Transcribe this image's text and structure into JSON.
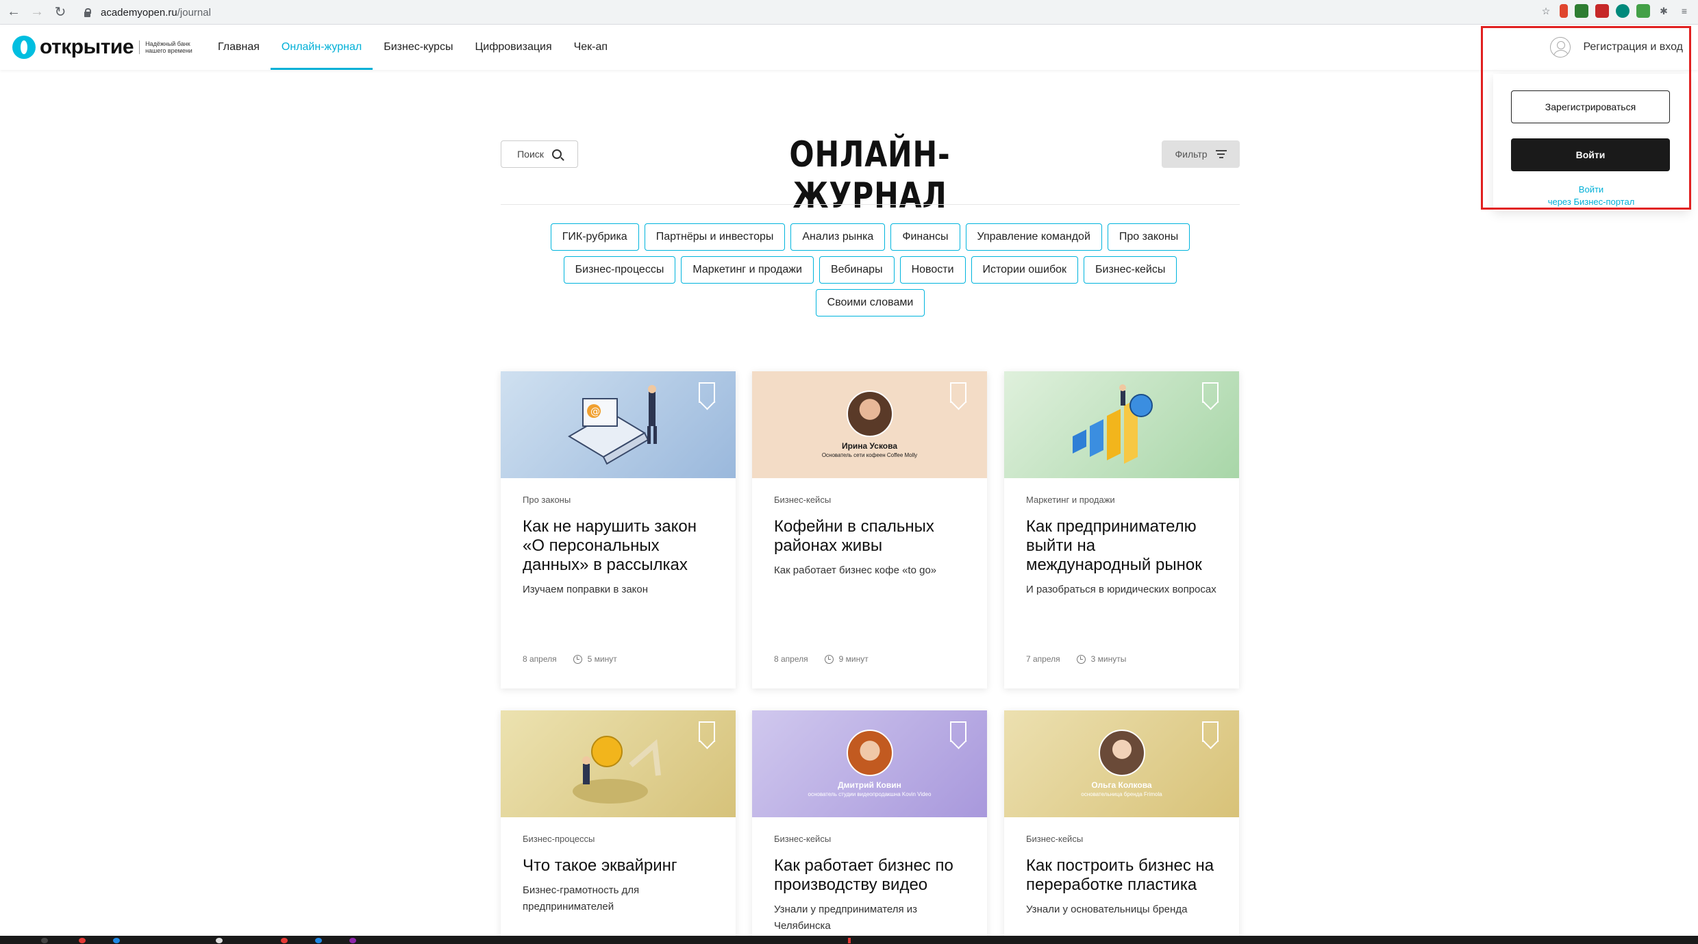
{
  "browser": {
    "url_host": "academyopen.ru",
    "url_path": "/journal"
  },
  "site": {
    "logo_text": "открытие",
    "logo_tagline": "Надёжный банк нашего времени",
    "nav": [
      "Главная",
      "Онлайн-журнал",
      "Бизнес-курсы",
      "Цифровизация",
      "Чек-ап"
    ],
    "auth_link": "Регистрация и вход"
  },
  "auth_dropdown": {
    "register": "Зарегистрироваться",
    "login": "Войти",
    "portal_line1": "Войти",
    "portal_line2": "через Бизнес-портал"
  },
  "journal": {
    "search_label": "Поиск",
    "title": "ОНЛАЙН-ЖУРНАЛ",
    "filter_label": "Фильтр",
    "tags_row1": [
      "ГИК-рубрика",
      "Партнёры и инвесторы",
      "Анализ рынка",
      "Финансы",
      "Управление командой",
      "Про законы"
    ],
    "tags_row2": [
      "Бизнес-процессы",
      "Маркетинг и продажи",
      "Вебинары",
      "Новости",
      "Истории ошибок",
      "Бизнес-кейсы"
    ],
    "tags_row3": [
      "Своими словами"
    ]
  },
  "cards": [
    {
      "category": "Про законы",
      "title": "Как не нарушить закон «О персональных данных» в рассылках",
      "subtitle": "Изучаем поправки в закон",
      "date": "8 апреля",
      "read_time": "5 минут",
      "bg": "#b3cce6"
    },
    {
      "category": "Бизнес-кейсы",
      "title": "Кофейни в спальных районах живы",
      "subtitle": "Как работает бизнес кофе «to go»",
      "date": "8 апреля",
      "read_time": "9 минут",
      "bg": "#f3dcc6",
      "person_name": "Ирина Ускова",
      "person_role": "Основатель сети кофеен Coffee Molly"
    },
    {
      "category": "Маркетинг и продажи",
      "title": "Как предпринимателю выйти на международный рынок",
      "subtitle": "И разобраться в юридических вопросах",
      "date": "7 апреля",
      "read_time": "3 минуты",
      "bg": "#bfe0bf"
    },
    {
      "category": "Бизнес-процессы",
      "title": "Что такое эквайринг",
      "subtitle": "Бизнес-грамотность для предпринимателей",
      "bg": "#e3d8a0"
    },
    {
      "category": "Бизнес-кейсы",
      "title": "Как работает бизнес по производству видео",
      "subtitle": "Узнали у предпринимателя из Челябинска",
      "bg": "#c0b8e6",
      "person_name": "Дмитрий Ковин",
      "person_role": "основатель студии видеопродакшна Kovin Video"
    },
    {
      "category": "Бизнес-кейсы",
      "title": "Как построить бизнес на переработке пластика",
      "subtitle": "Узнали у основательницы бренда",
      "bg": "#e3d39a",
      "person_name": "Ольга Колкова",
      "person_role": "основательница бренда Frimola"
    }
  ],
  "colors": {
    "accent": "#00b0d7",
    "highlight": "#e12020",
    "dark_button": "#1a1a1a"
  }
}
